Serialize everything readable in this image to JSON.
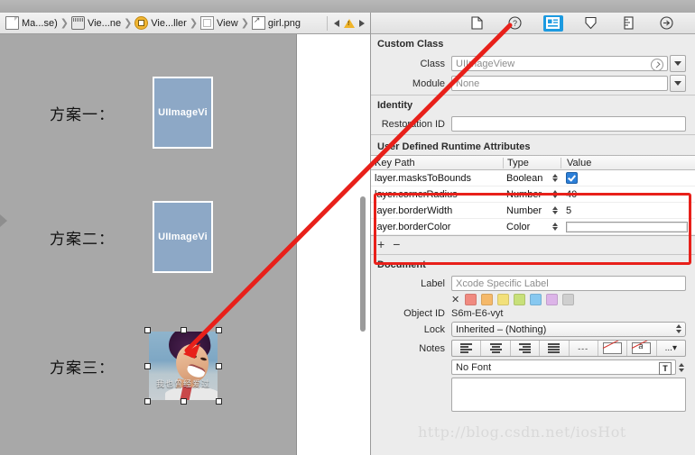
{
  "breadcrumb": {
    "items": [
      {
        "label": "Ma...se)",
        "icon": "document-icon"
      },
      {
        "label": "Vie...ne",
        "icon": "storyboard-icon"
      },
      {
        "label": "Vie...ller",
        "icon": "view-controller-icon"
      },
      {
        "label": "View",
        "icon": "view-icon"
      },
      {
        "label": "girl.png",
        "icon": "image-asset-icon"
      }
    ],
    "nav_back": "◀",
    "nav_forward": "▶",
    "warning_icon": "warning-triangle-icon"
  },
  "canvas": {
    "rows": [
      {
        "label": "方案一：",
        "placeholder_text": "UIImageVi"
      },
      {
        "label": "方案二：",
        "placeholder_text": "UIImageVi"
      },
      {
        "label": "方案三：",
        "photo_caption": "我也曾经爱过"
      }
    ],
    "placeholder_color": "#8da8c6",
    "background_color": "#a8a8a8"
  },
  "inspector": {
    "toolbar": [
      {
        "name": "file-inspector-icon",
        "selected": false
      },
      {
        "name": "quick-help-inspector-icon",
        "selected": false
      },
      {
        "name": "identity-inspector-icon",
        "selected": true
      },
      {
        "name": "attributes-inspector-icon",
        "selected": false
      },
      {
        "name": "size-inspector-icon",
        "selected": false
      },
      {
        "name": "connections-inspector-icon",
        "selected": false
      }
    ],
    "selected_accent": "#1c9ae0",
    "custom_class": {
      "title": "Custom Class",
      "class_label": "Class",
      "class_value": "UIImageView",
      "module_label": "Module",
      "module_value": "None"
    },
    "identity": {
      "title": "Identity",
      "restoration_id_label": "Restoration ID",
      "restoration_id_value": ""
    },
    "runtime_attributes": {
      "title": "User Defined Runtime Attributes",
      "columns": [
        "Key Path",
        "Type",
        "Value"
      ],
      "rows": [
        {
          "key": "layer.masksToBounds",
          "type": "Boolean",
          "value": "",
          "value_kind": "checkbox",
          "checked": true
        },
        {
          "key": "layer.cornerRadius",
          "type": "Number",
          "value": "40",
          "value_kind": "text"
        },
        {
          "key": "layer.borderWidth",
          "type": "Number",
          "value": "5",
          "value_kind": "text"
        },
        {
          "key": "layer.borderColor",
          "type": "Color",
          "value": "",
          "value_kind": "colorbar"
        }
      ],
      "add_button": "+",
      "remove_button": "−",
      "highlight_color": "#e8201a"
    },
    "document": {
      "title": "Document",
      "label_label": "Label",
      "label_placeholder": "Xcode Specific Label",
      "swatch_clear": "✕",
      "swatches": [
        "#f08a80",
        "#f5b96a",
        "#f2e07a",
        "#c8e07a",
        "#87c8f0",
        "#dcb4e8",
        "#cfcfcf"
      ],
      "object_id_label": "Object ID",
      "object_id_value": "S6m-E6-vyt",
      "lock_label": "Lock",
      "lock_value": "Inherited – (Nothing)",
      "notes_label": "Notes",
      "notes_dash": "---",
      "notes_more": "...▾",
      "font_value": "No Font",
      "notes_text": ""
    }
  },
  "watermark": "http://blog.csdn.net/iosHot"
}
